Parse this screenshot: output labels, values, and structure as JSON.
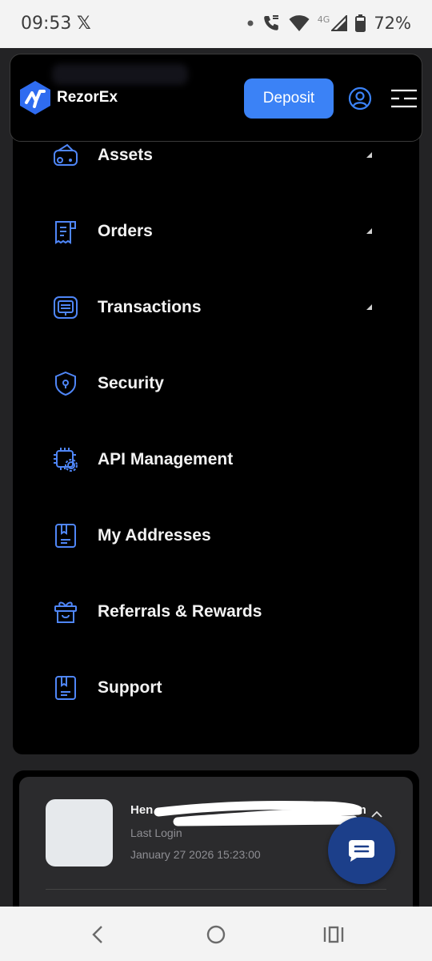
{
  "status_bar": {
    "time": "09:53",
    "x_logo": "𝕏",
    "network_label": "4G",
    "battery": "72%"
  },
  "header": {
    "brand": "RezorEx",
    "deposit_label": "Deposit",
    "icons": [
      "rezorex-logo-icon",
      "user-icon",
      "menu-icon"
    ]
  },
  "menu": {
    "items": [
      {
        "label": "Assets",
        "icon": "wallet-icon",
        "expandable": true
      },
      {
        "label": "Orders",
        "icon": "receipt-icon",
        "expandable": true
      },
      {
        "label": "Transactions",
        "icon": "transactions-icon",
        "expandable": true
      },
      {
        "label": "Security",
        "icon": "shield-icon",
        "expandable": false
      },
      {
        "label": "API Management",
        "icon": "api-chip-icon",
        "expandable": false
      },
      {
        "label": "My Addresses",
        "icon": "address-book-icon",
        "expandable": false
      },
      {
        "label": "Referrals & Rewards",
        "icon": "gift-icon",
        "expandable": false
      },
      {
        "label": "Support",
        "icon": "support-icon",
        "expandable": false
      }
    ]
  },
  "account": {
    "email_start": "Hen",
    "email_end": "om",
    "last_login_label": "Last Login",
    "last_login_value": "January 27 2026 15:23:00"
  },
  "colors": {
    "accent": "#3b82f6",
    "icon_blue": "#4f86f7",
    "panel_bg": "#000000",
    "page_bg": "#232325",
    "chat_fab": "#1c3f8a"
  }
}
